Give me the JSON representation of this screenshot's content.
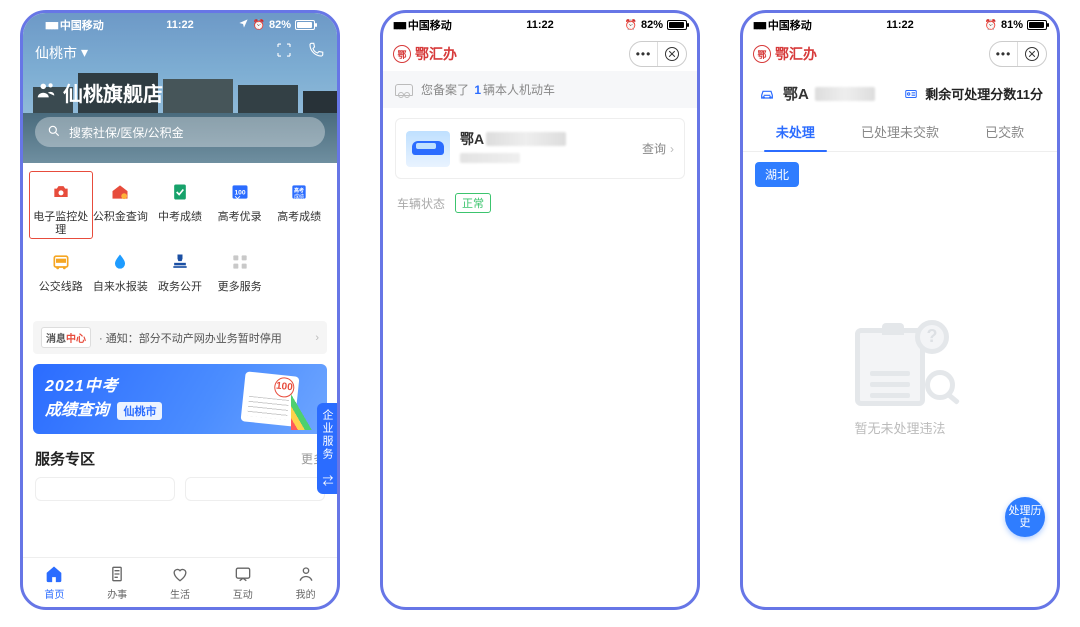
{
  "status": {
    "carrier": "中国移动",
    "time": "11:22",
    "battery1": "82%",
    "battery2": "82%",
    "battery3": "81%"
  },
  "s1": {
    "city": "仙桃市",
    "store": "仙桃旗舰店",
    "search_placeholder": "搜索社保/医保/公积金",
    "services": [
      {
        "label": "电子监控处理",
        "color": "#e74c3c"
      },
      {
        "label": "公积金查询",
        "color": "#e74c3c"
      },
      {
        "label": "中考成绩",
        "color": "#17a26b"
      },
      {
        "label": "高考优录",
        "color": "#2b6cff"
      },
      {
        "label": "高考成绩",
        "color": "#2b6cff"
      },
      {
        "label": "公交线路",
        "color": "#f5a623"
      },
      {
        "label": "自来水报装",
        "color": "#1e9cff"
      },
      {
        "label": "政务公开",
        "color": "#1b4fa3"
      },
      {
        "label": "更多服务",
        "color": "#c9c9c9"
      }
    ],
    "notice_badge_a": "消息",
    "notice_badge_b": "中心",
    "notice_text": "· 通知：部分不动产网办业务暂时停用",
    "banner_line1": "2021中考",
    "banner_line2": "成绩查询",
    "banner_city": "仙桃市",
    "side_tab": "企业服务",
    "section_title": "服务专区",
    "section_more": "更多",
    "tabs": [
      {
        "label": "首页"
      },
      {
        "label": "办事"
      },
      {
        "label": "生活"
      },
      {
        "label": "互动"
      },
      {
        "label": "我的"
      }
    ]
  },
  "app_name": "鄂汇办",
  "s2": {
    "band_a": "您备案了",
    "band_count": "1",
    "band_b": "辆本人机动车",
    "plate_prefix": "鄂A",
    "query": "查询",
    "status_label": "车辆状态",
    "status_value": "正常"
  },
  "s3": {
    "plate_prefix": "鄂A",
    "points_text": "剩余可处理分数11分",
    "tabs": [
      "未处理",
      "已处理未交款",
      "已交款"
    ],
    "region": "湖北",
    "empty": "暂无未处理违法",
    "float": "处理历史"
  }
}
